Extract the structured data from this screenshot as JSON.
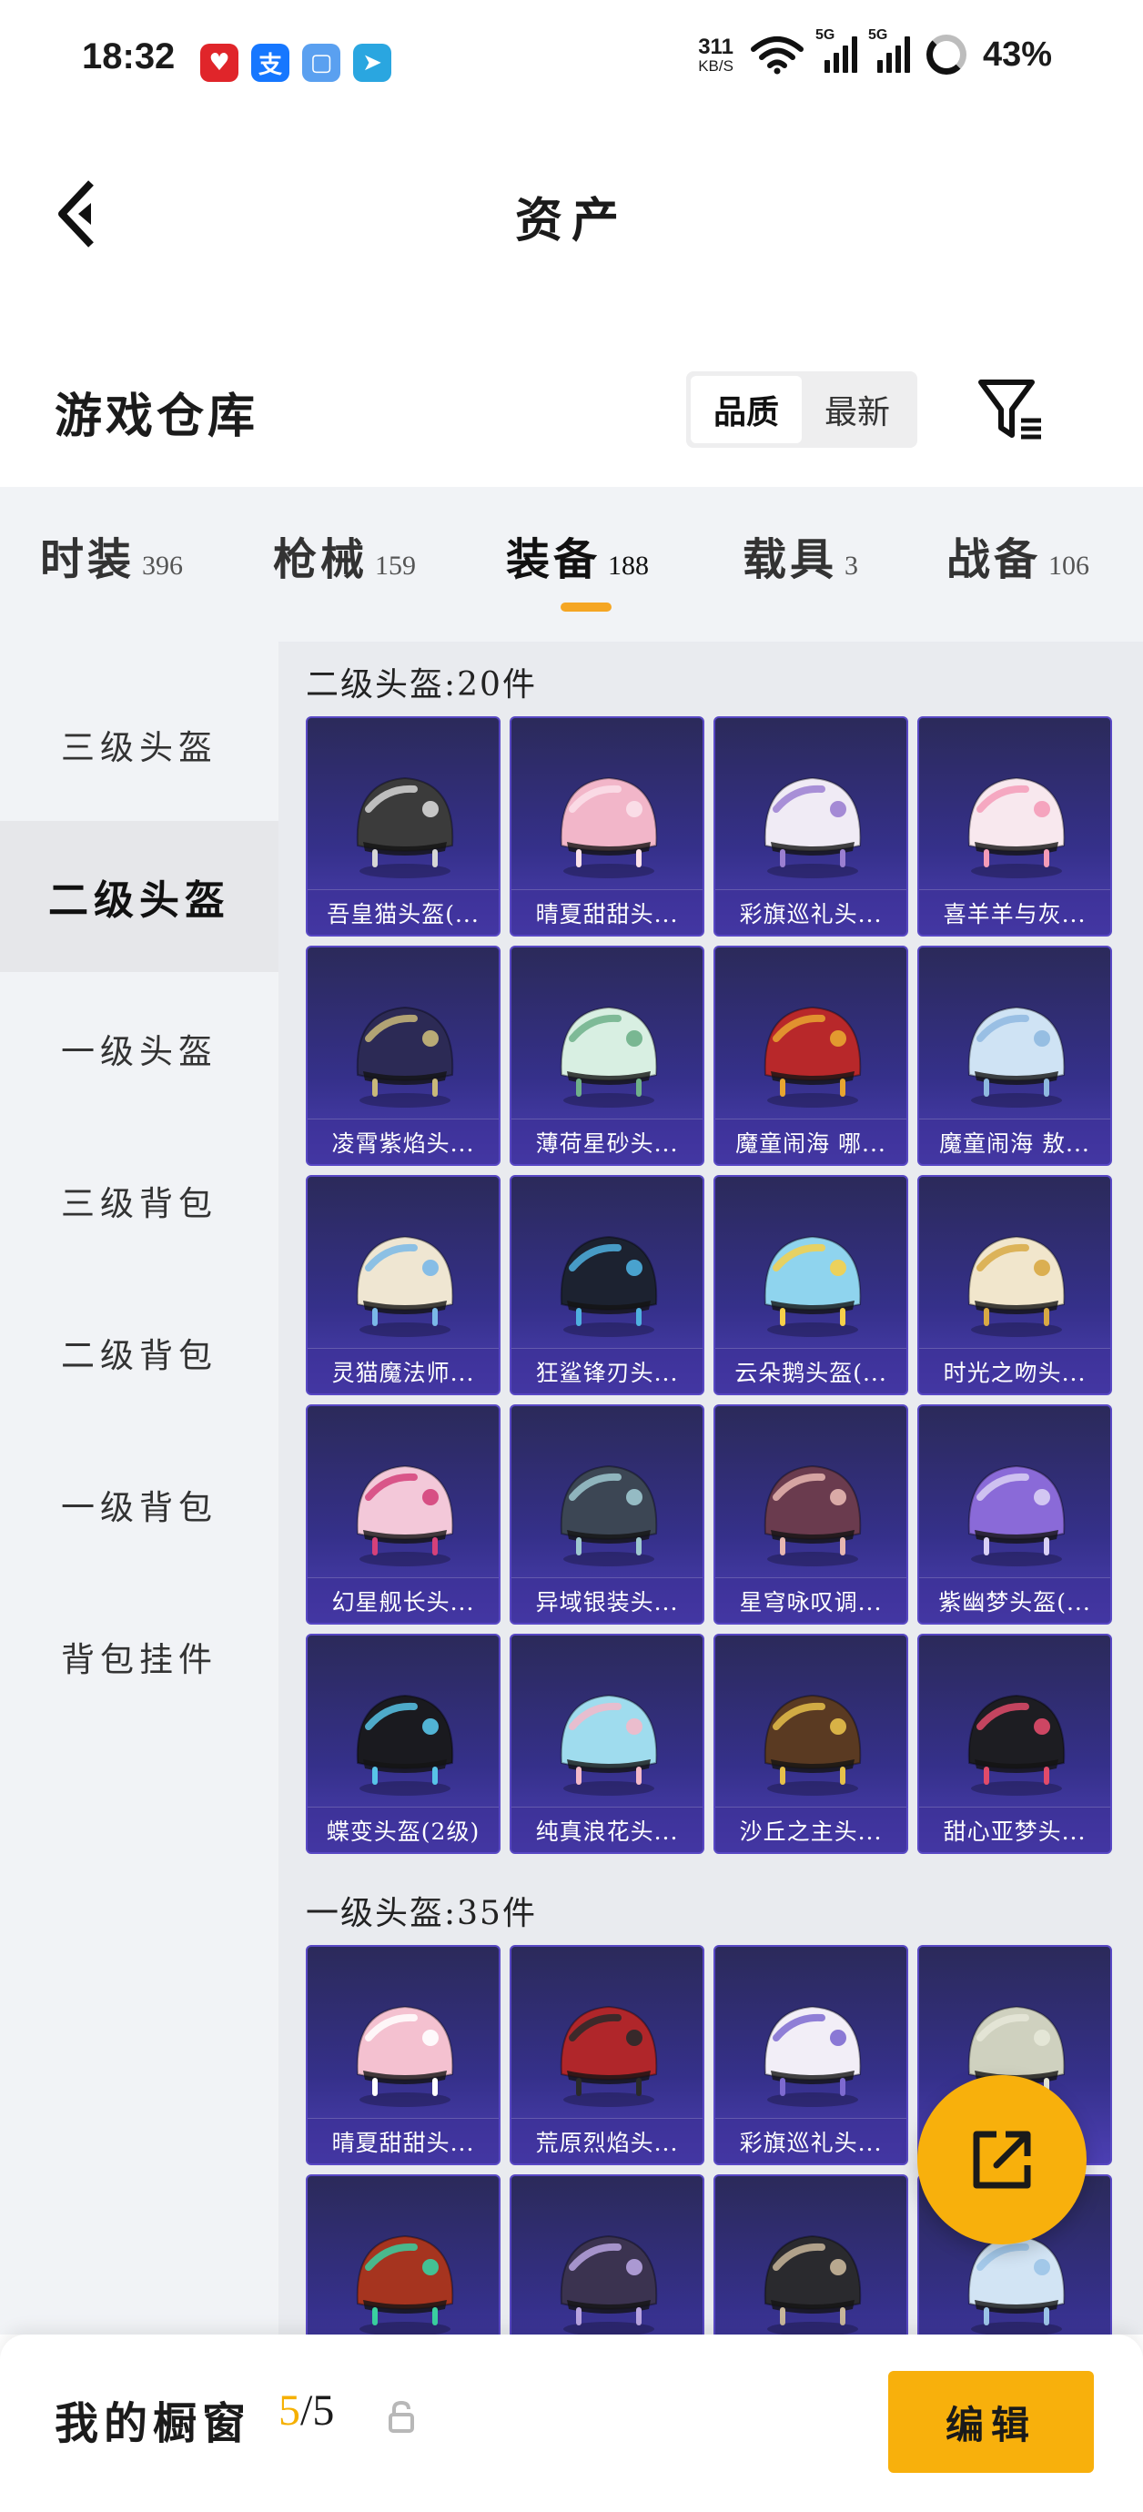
{
  "status_bar": {
    "time": "18:32",
    "net_speed_value": "311",
    "net_speed_unit": "KB/S",
    "signal_1": "5G",
    "signal_2": "5G",
    "battery": "43%",
    "app_icons": [
      {
        "name": "pinduoduo-icon",
        "color": "#e0252a",
        "glyph": "♥"
      },
      {
        "name": "alipay-icon",
        "color": "#1677ff",
        "glyph": "支"
      },
      {
        "name": "gallery-app-icon",
        "color": "#5aa0f0",
        "glyph": "▢"
      },
      {
        "name": "telegram-icon",
        "color": "#2aa6e0",
        "glyph": "➤"
      }
    ]
  },
  "header": {
    "title": "资产"
  },
  "warehouse": {
    "title": "游戏仓库",
    "sort_options": [
      "品质",
      "最新"
    ],
    "active_sort": "品质"
  },
  "tabs": [
    {
      "name": "时装",
      "count": "396",
      "active": false
    },
    {
      "name": "枪械",
      "count": "159",
      "active": false
    },
    {
      "name": "装备",
      "count": "188",
      "active": true
    },
    {
      "name": "载具",
      "count": "3",
      "active": false
    },
    {
      "name": "战备",
      "count": "106",
      "active": false
    }
  ],
  "sidebar": {
    "items": [
      {
        "label": "三级头盔",
        "active": false
      },
      {
        "label": "二级头盔",
        "active": true
      },
      {
        "label": "一级头盔",
        "active": false
      },
      {
        "label": "三级背包",
        "active": false
      },
      {
        "label": "二级背包",
        "active": false
      },
      {
        "label": "一级背包",
        "active": false
      },
      {
        "label": "背包挂件",
        "active": false
      }
    ]
  },
  "sections": [
    {
      "title": "二级头盔:20件",
      "items": [
        {
          "name": "吾皇猫头盔(...",
          "color": "#3b3b3b",
          "accent": "#d6d6d6"
        },
        {
          "name": "晴夏甜甜头...",
          "color": "#f2b6c9",
          "accent": "#fbe1ea"
        },
        {
          "name": "彩旗巡礼头...",
          "color": "#f0ebf5",
          "accent": "#9b7fd1"
        },
        {
          "name": "喜羊羊与灰...",
          "color": "#f8e8ee",
          "accent": "#f49cb8"
        },
        {
          "name": "凌霄紫焰头...",
          "color": "#2c2a55",
          "accent": "#c9b87a"
        },
        {
          "name": "薄荷星砂头...",
          "color": "#d8efe2",
          "accent": "#6fb08a"
        },
        {
          "name": "魔童闹海 哪...",
          "color": "#b8282a",
          "accent": "#e8a530"
        },
        {
          "name": "魔童闹海 敖...",
          "color": "#cfe3f4",
          "accent": "#8fb9e0"
        },
        {
          "name": "灵猫魔法师...",
          "color": "#efe6d2",
          "accent": "#7ab8e8"
        },
        {
          "name": "狂鲨锋刃头...",
          "color": "#1c2230",
          "accent": "#4fb0e0"
        },
        {
          "name": "云朵鹅头盔(...",
          "color": "#8fd4ee",
          "accent": "#f6d04a"
        },
        {
          "name": "时光之吻头...",
          "color": "#f1e6cc",
          "accent": "#d8a944"
        },
        {
          "name": "幻星舰长头...",
          "color": "#f3c8d9",
          "accent": "#d4417a"
        },
        {
          "name": "异域银装头...",
          "color": "#3c4654",
          "accent": "#9ec8d0"
        },
        {
          "name": "星穹咏叹调...",
          "color": "#6a3b4e",
          "accent": "#e7b7b1"
        },
        {
          "name": "紫幽梦头盔(...",
          "color": "#8a6ad8",
          "accent": "#d9d0f5"
        },
        {
          "name": "蝶变头盔(2级)",
          "color": "#1a1a1f",
          "accent": "#58c4e8"
        },
        {
          "name": "纯真浪花头...",
          "color": "#9fdcee",
          "accent": "#f3b9c9"
        },
        {
          "name": "沙丘之主头...",
          "color": "#5a3a22",
          "accent": "#e6c04a"
        },
        {
          "name": "甜心亚梦头...",
          "color": "#1d1d22",
          "accent": "#e14b6a"
        }
      ]
    },
    {
      "title": "一级头盔:35件",
      "items": [
        {
          "name": "晴夏甜甜头...",
          "color": "#f4c1d0",
          "accent": "#ffffff"
        },
        {
          "name": "荒原烈焰头...",
          "color": "#b0262a",
          "accent": "#2a2a2a"
        },
        {
          "name": "彩旗巡礼头...",
          "color": "#f2eef7",
          "accent": "#7e6ad0"
        },
        {
          "name": "",
          "color": "#cfd1bf",
          "accent": "#e6e8d8"
        },
        {
          "name": "",
          "color": "#a6341f",
          "accent": "#3ad0a0"
        },
        {
          "name": "",
          "color": "#3b3350",
          "accent": "#b8a4e0"
        },
        {
          "name": "",
          "color": "#2a2a2e",
          "accent": "#c8b69a"
        },
        {
          "name": "",
          "color": "#d2e4f4",
          "accent": "#9cc4e8"
        }
      ]
    }
  ],
  "bottom_bar": {
    "showcase_label": "我的橱窗",
    "showcase_current": "5",
    "showcase_total": "/5",
    "edit_label": "编辑"
  },
  "colors": {
    "accent": "#f8b00c",
    "tab_indicator": "#f5a623",
    "card_bg": "#35308a"
  }
}
